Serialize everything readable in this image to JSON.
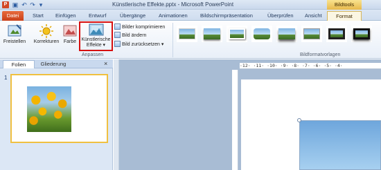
{
  "titlebar": {
    "app_icon": "P",
    "title": "Künstlerische Effekte.pptx - Microsoft PowerPoint",
    "context_tab": "Bildtools"
  },
  "tabs": [
    "Datei",
    "Start",
    "Einfügen",
    "Entwurf",
    "Übergänge",
    "Animationen",
    "Bildschirmpräsentation",
    "Überprüfen",
    "Ansicht",
    "Format"
  ],
  "ribbon": {
    "freistellen": "Freistellen",
    "korrekturen": "Korrekturen",
    "farbe": "Farbe",
    "kuenstlerische_line1": "Künstlerische",
    "kuenstlerische_line2": "Effekte",
    "bilder_komprimieren": "Bilder komprimieren",
    "bild_aendern": "Bild ändern",
    "bild_zuruecksetzen": "Bild zurücksetzen",
    "group_anpassen": "Anpassen",
    "group_bildformatvorlagen": "Bildformatvorlagen"
  },
  "leftpane": {
    "tab_folien": "Folien",
    "tab_gliederung": "Gliederung",
    "close": "×",
    "slide_number": "1"
  },
  "ruler_text": "·12·  ·11·  ·10·  ·9·  ·8·  ·7·  ·6·  ·5·  ·4·",
  "colors": {
    "datei_tab": "#d2521f",
    "bildtools": "#e7b94c",
    "highlight_box": "#d60f0f"
  }
}
